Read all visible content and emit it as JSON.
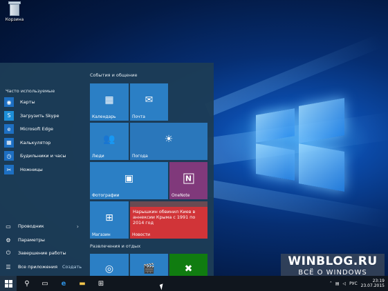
{
  "desktop": {
    "recycle_bin_label": "Корзина"
  },
  "start_menu": {
    "frequent_header": "Часто используемые",
    "apps": [
      {
        "label": "Карты",
        "icon": "camera-icon",
        "color": "#1d6fc2",
        "glyph": "◉"
      },
      {
        "label": "Загрузить Skype",
        "icon": "skype-icon",
        "color": "#1d8fd8",
        "glyph": "S"
      },
      {
        "label": "Microsoft Edge",
        "icon": "edge-icon",
        "color": "#1d6fc2",
        "glyph": "e"
      },
      {
        "label": "Калькулятор",
        "icon": "calculator-icon",
        "color": "#1d6fc2",
        "glyph": "▦"
      },
      {
        "label": "Будильники и часы",
        "icon": "clock-icon",
        "color": "#1d6fc2",
        "glyph": "◷"
      },
      {
        "label": "Ножницы",
        "icon": "scissors-icon",
        "color": "#1d6fc2",
        "glyph": "✂"
      }
    ],
    "bottom": {
      "explorer": "Проводник",
      "settings": "Параметры",
      "power": "Завершение работы",
      "all_apps": "Все приложения",
      "new": "Создать"
    },
    "groups": {
      "life": "События и общение",
      "play": "Развлечения и отдых"
    },
    "tiles": {
      "calendar": "Календарь",
      "mail": "Почта",
      "people": "Люди",
      "weather": "Погода",
      "photos": "Фотографии",
      "onenote": "OneNote",
      "store": "Магазин",
      "news_headline": "Нарышкин обвинил Киев в аннексии Крыма с 1991 по 2014 год",
      "news": "Новости"
    }
  },
  "taskbar": {
    "language": "РУС",
    "time": "23:19",
    "date": "23.07.2015"
  },
  "watermark": {
    "line1": "WINBLOG.RU",
    "line2": "ВСЁ О WINDOWS"
  },
  "colors": {
    "accent": "#2b7fc5",
    "start_bg": "#1c3c56",
    "news_red": "#d13438",
    "onenote_purple": "#80397b",
    "xbox_green": "#107c10"
  }
}
